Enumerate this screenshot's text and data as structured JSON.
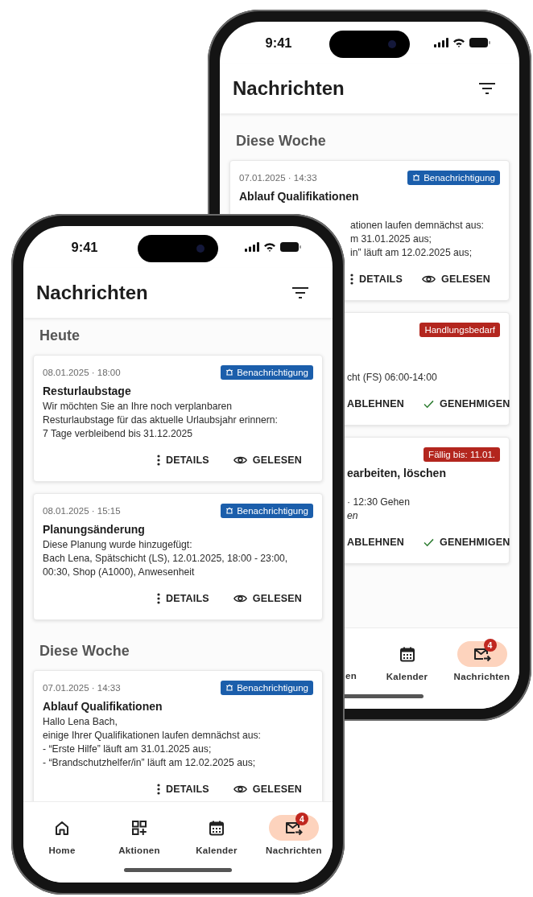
{
  "phones": [
    {
      "status_bar": {
        "time": "9:41"
      },
      "header": {
        "title": "Nachrichten"
      },
      "sections": [
        {
          "heading": "Diese Woche",
          "cards": [
            {
              "date": "07.01.2025 · 14:33",
              "badge": {
                "text": "Benachrichtigung",
                "kind": "info"
              },
              "title": "Ablauf Qualifikationen",
              "body": "ationen laufen demnächst aus:\nm 31.01.2025 aus;\nin” läuft am 12.02.2025 aus;",
              "actions": [
                {
                  "label": "DETAILS",
                  "kind": "details"
                },
                {
                  "label": "GELESEN",
                  "kind": "read"
                }
              ]
            },
            {
              "badge": {
                "text": "Handlungsbedarf",
                "kind": "action"
              },
              "body": "cht (FS) 06:00-14:00",
              "actions": [
                {
                  "label": "ABLEHNEN",
                  "kind": "reject"
                },
                {
                  "label": "GENEHMIGEN",
                  "kind": "approve"
                }
              ]
            },
            {
              "badge": {
                "text": "Fällig bis: 11.01.",
                "kind": "action"
              },
              "title": "earbeiten, löschen",
              "body": "· 12:30 Gehen\n*en*",
              "actions": [
                {
                  "label": "ABLEHNEN",
                  "kind": "reject"
                },
                {
                  "label": "GENEHMIGEN",
                  "kind": "approve"
                }
              ]
            }
          ]
        }
      ],
      "nav": [
        {
          "label": "en",
          "kind": "label",
          "selected": false
        },
        {
          "label": "Kalender",
          "kind": "calendar",
          "selected": false
        },
        {
          "label": "Nachrichten",
          "kind": "mail",
          "selected": true,
          "badge": "4"
        }
      ]
    },
    {
      "status_bar": {
        "time": "9:41"
      },
      "header": {
        "title": "Nachrichten"
      },
      "sections": [
        {
          "heading": "Heute",
          "cards": [
            {
              "date": "08.01.2025 · 18:00",
              "badge": {
                "text": "Benachrichtigung",
                "kind": "info"
              },
              "title": "Resturlaubstage",
              "body": "Wir möchten Sie an Ihre noch verplanbaren\nResturlaubstage für das aktuelle Urlaubsjahr erinnern:\n7 Tage verbleibend bis 31.12.2025",
              "actions": [
                {
                  "label": "DETAILS",
                  "kind": "details"
                },
                {
                  "label": "GELESEN",
                  "kind": "read"
                }
              ]
            },
            {
              "date": "08.01.2025 · 15:15",
              "badge": {
                "text": "Benachrichtigung",
                "kind": "info"
              },
              "title": "Planungsänderung",
              "body": "Diese Planung wurde hinzugefügt:\nBach Lena, Spätschicht (LS), 12.01.2025, 18:00 - 23:00,\n00:30, Shop (A1000), Anwesenheit",
              "actions": [
                {
                  "label": "DETAILS",
                  "kind": "details"
                },
                {
                  "label": "GELESEN",
                  "kind": "read"
                }
              ]
            }
          ]
        },
        {
          "heading": "Diese Woche",
          "cards": [
            {
              "date": "07.01.2025 · 14:33",
              "badge": {
                "text": "Benachrichtigung",
                "kind": "info"
              },
              "title": "Ablauf Qualifikationen",
              "body": "Hallo Lena Bach,\neinige Ihrer Qualifikationen laufen demnächst aus:\n - “Erste Hilfe” läuft am 31.01.2025 aus;\n - “Brandschutzhelfer/in” läuft am 12.02.2025 aus;",
              "actions": [
                {
                  "label": "DETAILS",
                  "kind": "details"
                },
                {
                  "label": "GELESEN",
                  "kind": "read"
                }
              ]
            }
          ]
        }
      ],
      "nav": [
        {
          "label": "Home",
          "kind": "home",
          "selected": false
        },
        {
          "label": "Aktionen",
          "kind": "grid",
          "selected": false
        },
        {
          "label": "Kalender",
          "kind": "calendar",
          "selected": false
        },
        {
          "label": "Nachrichten",
          "kind": "mail",
          "selected": true,
          "badge": "4"
        }
      ]
    }
  ]
}
